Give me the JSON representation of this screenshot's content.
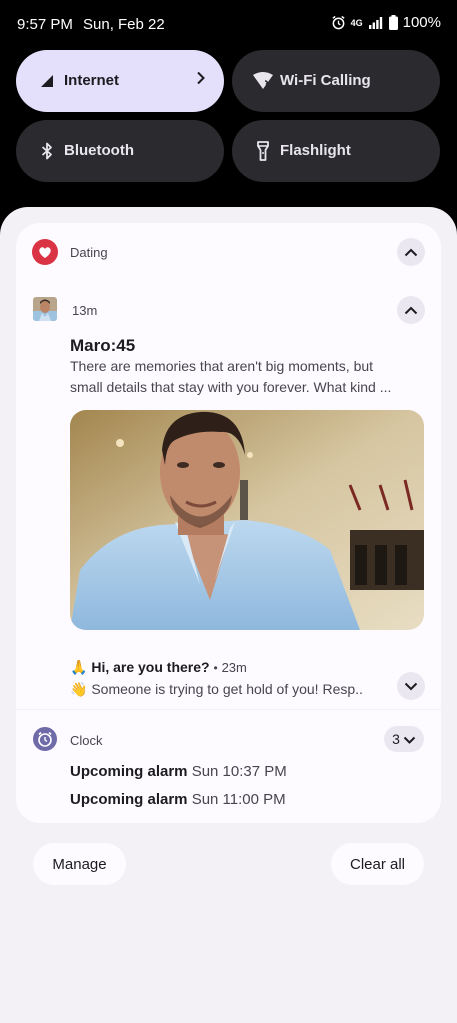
{
  "status_bar": {
    "time": "9:57 PM",
    "date": "Sun, Feb 22",
    "network": "4G",
    "battery": "100%"
  },
  "quick_tiles": [
    {
      "label": "Internet",
      "icon": "signal-icon",
      "active": true
    },
    {
      "label": "Wi-Fi Calling",
      "icon": "wifi-calling-icon",
      "active": false
    },
    {
      "label": "Bluetooth",
      "icon": "bluetooth-icon",
      "active": false
    },
    {
      "label": "Flashlight",
      "icon": "flashlight-icon",
      "active": false
    }
  ],
  "dating": {
    "app_name": "Dating",
    "time_ago": "13m",
    "title": "Maro:45",
    "body_line1": "There are memories that aren't big moments, but",
    "body_line2": "small details that stay with you forever. What kind ...",
    "second_title": "Hi, are you there?",
    "second_emoji": "🙏",
    "second_time": "23m",
    "second_body": "Someone is trying to get hold of you! Resp..",
    "second_body_emoji": "👋"
  },
  "clock": {
    "app_name": "Clock",
    "count": "3",
    "alarms": [
      {
        "label": "Upcoming alarm",
        "time": "Sun 10:37 PM"
      },
      {
        "label": "Upcoming alarm",
        "time": "Sun 11:00 PM"
      }
    ]
  },
  "footer": {
    "manage_label": "Manage",
    "clear_label": "Clear all"
  },
  "colors": {
    "accent_tile": "#e4e0fb",
    "dating_brand": "#d93344",
    "clock_brand": "#6f6aa8"
  }
}
